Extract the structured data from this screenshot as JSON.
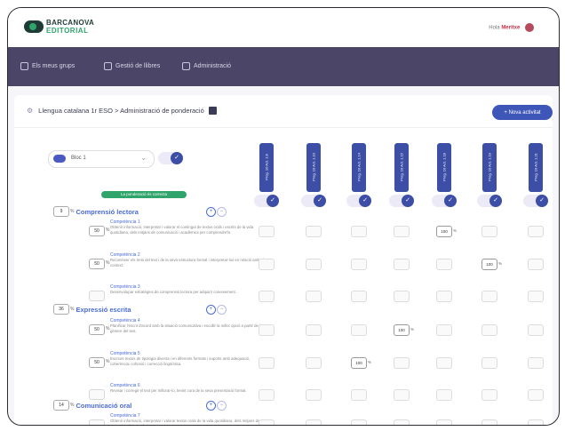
{
  "header": {
    "brand_line1": "BARCANOVA",
    "brand_line2": "EDITORIAL",
    "greeting": "Hola",
    "user_name": "Meritxe",
    "brand_color": "#1f3b35",
    "accent_color": "#2fa56b"
  },
  "nav": {
    "items": [
      {
        "label": "Els meus grups",
        "icon": "users-icon"
      },
      {
        "label": "Gestió de llibres",
        "icon": "book-icon"
      },
      {
        "label": "Administració",
        "icon": "settings-icon"
      }
    ],
    "color": "#4b4668"
  },
  "page": {
    "title": "Llengua catalana 1r ESO > Administració de ponderació",
    "new_button": "+ Nova activitat"
  },
  "filter": {
    "block_value": "Bloc 1",
    "badge": "La ponderació és correcta"
  },
  "columns": [
    "Prog. 10 Act. 1.8",
    "Prog. 10 Act. 1.10",
    "Prog. 10 Act. 1.14",
    "Prog. 10 Act. 1.15",
    "Prog. 10 Act. 1.18",
    "Prog. 10 Act. 1.19",
    "Prog. 10 Act. 1.21"
  ],
  "sections": [
    {
      "number": "9",
      "title": "Comprensió lectora",
      "competencies": [
        {
          "name": "Competència 1",
          "value": "50",
          "desc": "Obtenir informació, interpretar i valorar el contingut de textos orals i escrits de la vida quotidiana, dels mitjans de comunicació i acadèmics per comprendre'ls.",
          "cells": [
            "",
            "",
            "",
            "",
            "100",
            "",
            ""
          ]
        },
        {
          "name": "Competència 2",
          "value": "50",
          "desc": "Reconèixer els trets del text i de la seva estructura formal i interpretar-los en relació amb el context.",
          "cells": [
            "",
            "",
            "",
            "",
            "",
            "100",
            ""
          ]
        },
        {
          "name": "Competència 3",
          "value": "",
          "desc": "Desenvolupar estratègies de comprensió lectora per adquirir coneixement.",
          "cells": [
            "",
            "",
            "",
            "",
            "",
            "",
            ""
          ]
        }
      ]
    },
    {
      "number": "36",
      "title": "Expressió escrita",
      "competencies": [
        {
          "name": "Competència 4",
          "value": "50",
          "desc": "Planificar l'escrit d'acord amb la situació comunicativa i escollir la millor opció a partir de la gènere del text.",
          "cells": [
            "",
            "",
            "",
            "100",
            "",
            "",
            ""
          ]
        },
        {
          "name": "Competència 5",
          "value": "50",
          "desc": "Escriure textos de tipologia diversa i en diferents formats i suports amb adequació, coherència, cohesió i correcció lingüística.",
          "cells": [
            "",
            "",
            "100",
            "",
            "",
            "",
            ""
          ]
        },
        {
          "name": "Competència 6",
          "value": "",
          "desc": "Revisar i corregir el text per millorar-lo, tenint cura de la seva presentació formal.",
          "cells": [
            "",
            "",
            "",
            "",
            "",
            "",
            ""
          ]
        }
      ]
    },
    {
      "number": "14",
      "title": "Comunicació oral",
      "competencies": [
        {
          "name": "Competència 7",
          "value": "",
          "desc": "Obtenir informació, interpretar i valorar textos orals de la vida quotidiana, dels mitjans de comunicació i acadèmics.",
          "cells": [
            "",
            "",
            "",
            "",
            "",
            "",
            ""
          ]
        }
      ]
    }
  ]
}
